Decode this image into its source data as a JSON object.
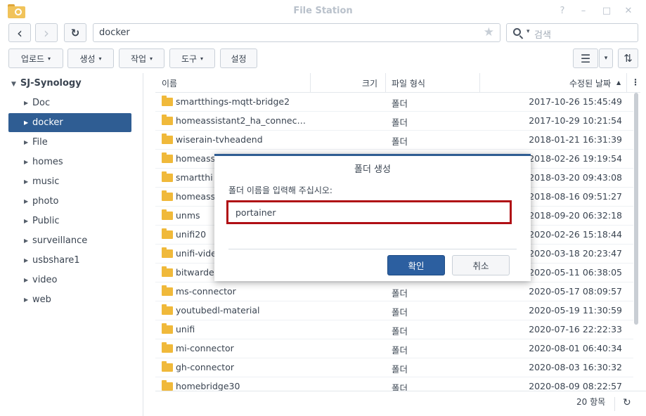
{
  "window": {
    "title": "File Station",
    "help": "?",
    "minimize": "–",
    "maximize": "□",
    "close": "✕"
  },
  "toolbar": {
    "back": "‹",
    "forward": "›",
    "refresh": "↻",
    "path": "docker",
    "star": "★",
    "search_caret": "▾",
    "search_placeholder": "검색",
    "menus": [
      {
        "label": "업로드",
        "arrow": "▾"
      },
      {
        "label": "생성",
        "arrow": "▾"
      },
      {
        "label": "작업",
        "arrow": "▾"
      },
      {
        "label": "도구",
        "arrow": "▾"
      },
      {
        "label": "설정",
        "arrow": ""
      }
    ],
    "view_icon": "☰",
    "view_caret": "▾",
    "sort_icon": "⇅"
  },
  "sidebar": {
    "root": "SJ-Synology",
    "root_arrow": "▼",
    "item_arrow": "▶",
    "items": [
      "Doc",
      "docker",
      "File",
      "homes",
      "music",
      "photo",
      "Public",
      "surveillance",
      "usbshare1",
      "video",
      "web"
    ],
    "selected": "docker"
  },
  "list": {
    "headers": {
      "name": "이름",
      "size": "크기",
      "type": "파일 형식",
      "date": "수정된 날짜",
      "sort_arrow": "▲",
      "more": "⋮"
    },
    "rows": [
      {
        "name": "smartthings-mqtt-bridge2",
        "type": "폴더",
        "date": "2017-10-26 15:45:49"
      },
      {
        "name": "homeassistant2_ha_connect...",
        "type": "폴더",
        "date": "2017-10-29 10:21:54"
      },
      {
        "name": "wiserain-tvheadend",
        "type": "폴더",
        "date": "2018-01-21 16:31:39"
      },
      {
        "name": "homeass",
        "type": "폴더",
        "date": "2018-02-26 19:19:54"
      },
      {
        "name": "smartthi",
        "type": "폴더",
        "date": "2018-03-20 09:43:08"
      },
      {
        "name": "homeass",
        "type": "폴더",
        "date": "2018-08-16 09:51:27"
      },
      {
        "name": "unms",
        "type": "폴더",
        "date": "2018-09-20 06:32:18"
      },
      {
        "name": "unifi20",
        "type": "폴더",
        "date": "2020-02-26 15:18:44"
      },
      {
        "name": "unifi-vide",
        "type": "폴더",
        "date": "2020-03-18 20:23:47"
      },
      {
        "name": "bitwarder",
        "type": "폴더",
        "date": "2020-05-11 06:38:05"
      },
      {
        "name": "ms-connector",
        "type": "폴더",
        "date": "2020-05-17 08:09:57"
      },
      {
        "name": "youtubedl-material",
        "type": "폴더",
        "date": "2020-05-19 11:30:59"
      },
      {
        "name": "unifi",
        "type": "폴더",
        "date": "2020-07-16 22:22:33"
      },
      {
        "name": "mi-connector",
        "type": "폴더",
        "date": "2020-08-01 06:40:34"
      },
      {
        "name": "gh-connector",
        "type": "폴더",
        "date": "2020-08-03 16:30:32"
      },
      {
        "name": "homebridge30",
        "type": "폴더",
        "date": "2020-08-09 08:22:57"
      }
    ],
    "count": "20 항목",
    "footer_refresh": "↻"
  },
  "dialog": {
    "title": "폴더 생성",
    "label": "폴더 이름을 입력해 주십시오:",
    "input_value": "portainer",
    "ok": "확인",
    "cancel": "취소"
  },
  "colors": {
    "accent": "#2f5d93",
    "highlight": "#b00f15",
    "folder": "#f0b93a"
  }
}
